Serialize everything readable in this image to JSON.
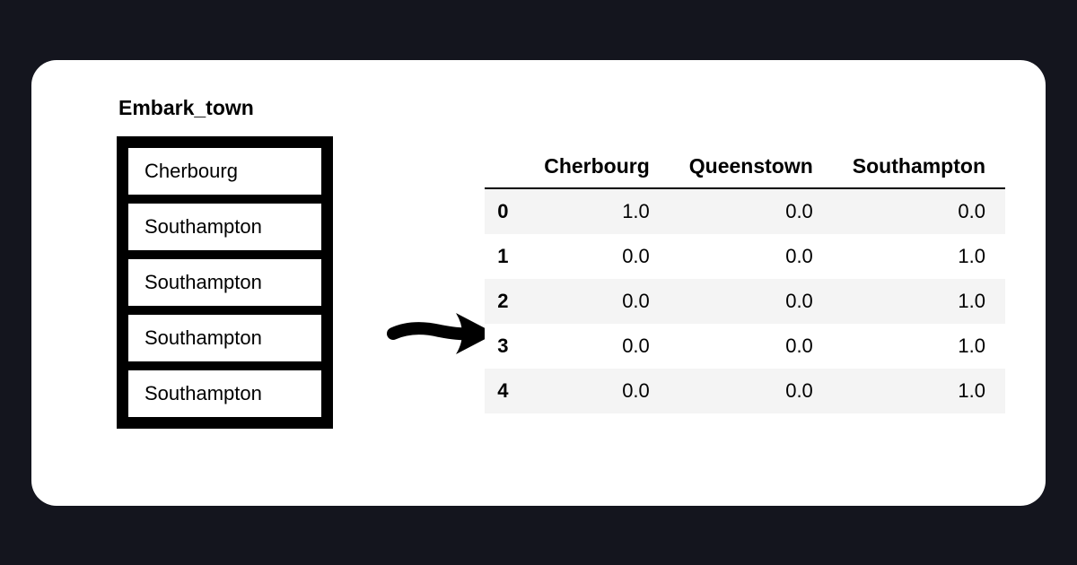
{
  "column_label": "Embark_town",
  "source_values": [
    "Cherbourg",
    "Southampton",
    "Southampton",
    "Southampton",
    "Southampton"
  ],
  "encoded": {
    "columns": [
      "Cherbourg",
      "Queenstown",
      "Southampton"
    ],
    "index": [
      "0",
      "1",
      "2",
      "3",
      "4"
    ],
    "rows": [
      [
        "1.0",
        "0.0",
        "0.0"
      ],
      [
        "0.0",
        "0.0",
        "1.0"
      ],
      [
        "0.0",
        "0.0",
        "1.0"
      ],
      [
        "0.0",
        "0.0",
        "1.0"
      ],
      [
        "0.0",
        "0.0",
        "1.0"
      ]
    ]
  }
}
